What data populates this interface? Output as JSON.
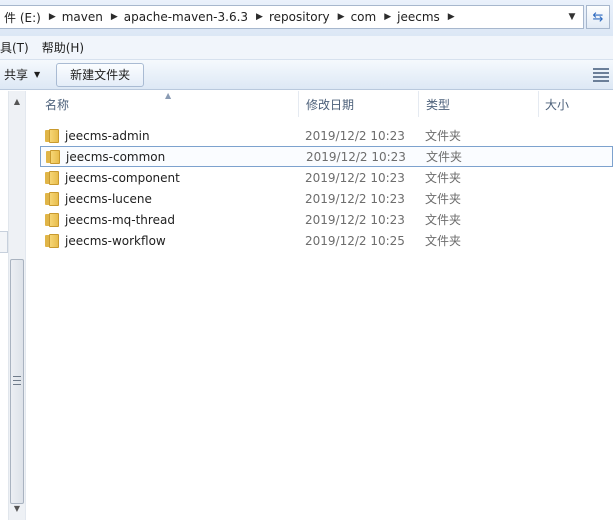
{
  "address": {
    "crumbs": [
      "件 (E:)",
      "maven",
      "apache-maven-3.6.3",
      "repository",
      "com",
      "jeecms"
    ]
  },
  "menu": {
    "items": [
      "具(T)",
      "帮助(H)"
    ]
  },
  "toolbar": {
    "share_label": "共享",
    "new_folder_label": "新建文件夹"
  },
  "columns": {
    "name": "名称",
    "modified": "修改日期",
    "type": "类型",
    "size": "大小"
  },
  "files": [
    {
      "name": "jeecms-admin",
      "modified": "2019/12/2 10:23",
      "type": "文件夹"
    },
    {
      "name": "jeecms-common",
      "modified": "2019/12/2 10:23",
      "type": "文件夹"
    },
    {
      "name": "jeecms-component",
      "modified": "2019/12/2 10:23",
      "type": "文件夹"
    },
    {
      "name": "jeecms-lucene",
      "modified": "2019/12/2 10:23",
      "type": "文件夹"
    },
    {
      "name": "jeecms-mq-thread",
      "modified": "2019/12/2 10:23",
      "type": "文件夹"
    },
    {
      "name": "jeecms-workflow",
      "modified": "2019/12/2 10:25",
      "type": "文件夹"
    }
  ],
  "icons": {
    "folder": "folder-icon",
    "refresh": "refresh-icon",
    "dropdown": "chevron-down-icon",
    "view": "view-options-icon"
  },
  "colors": {
    "selection_border": "#7da2ce",
    "folder": "#e8bd4d",
    "header_text": "#4c607a"
  }
}
